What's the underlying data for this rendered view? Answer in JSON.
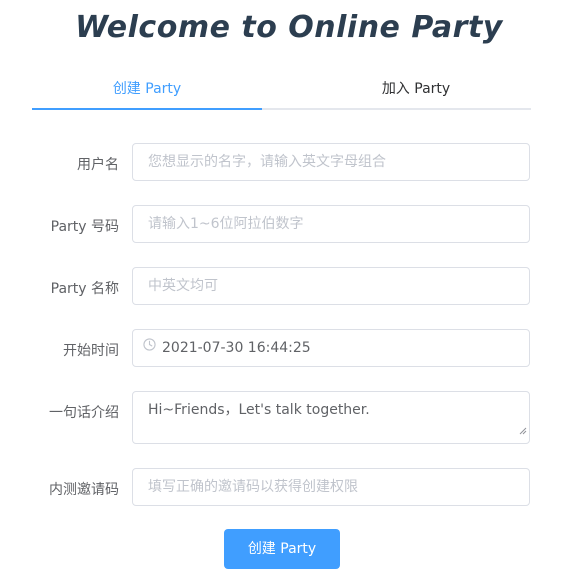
{
  "title": "Welcome to Online Party",
  "tabs": [
    {
      "label": "创建 Party",
      "active": true
    },
    {
      "label": "加入 Party",
      "active": false
    }
  ],
  "form": {
    "username": {
      "label": "用户名",
      "placeholder": "您想显示的名字，请输入英文字母组合"
    },
    "party_code": {
      "label": "Party 号码",
      "placeholder": "请输入1~6位阿拉伯数字"
    },
    "party_name": {
      "label": "Party 名称",
      "placeholder": "中英文均可"
    },
    "start_time": {
      "label": "开始时间",
      "value": "2021-07-30 16:44:25",
      "icon": "clock-icon"
    },
    "intro": {
      "label": "一句话介绍",
      "value": "Hi~Friends，Let's talk together."
    },
    "invite_code": {
      "label": "内测邀请码",
      "placeholder": "填写正确的邀请码以获得创建权限"
    }
  },
  "submit_label": "创建 Party",
  "colors": {
    "accent": "#409eff",
    "border": "#dcdfe6",
    "placeholder": "#c0c4cc",
    "text": "#606266",
    "title": "#2c3e50"
  }
}
